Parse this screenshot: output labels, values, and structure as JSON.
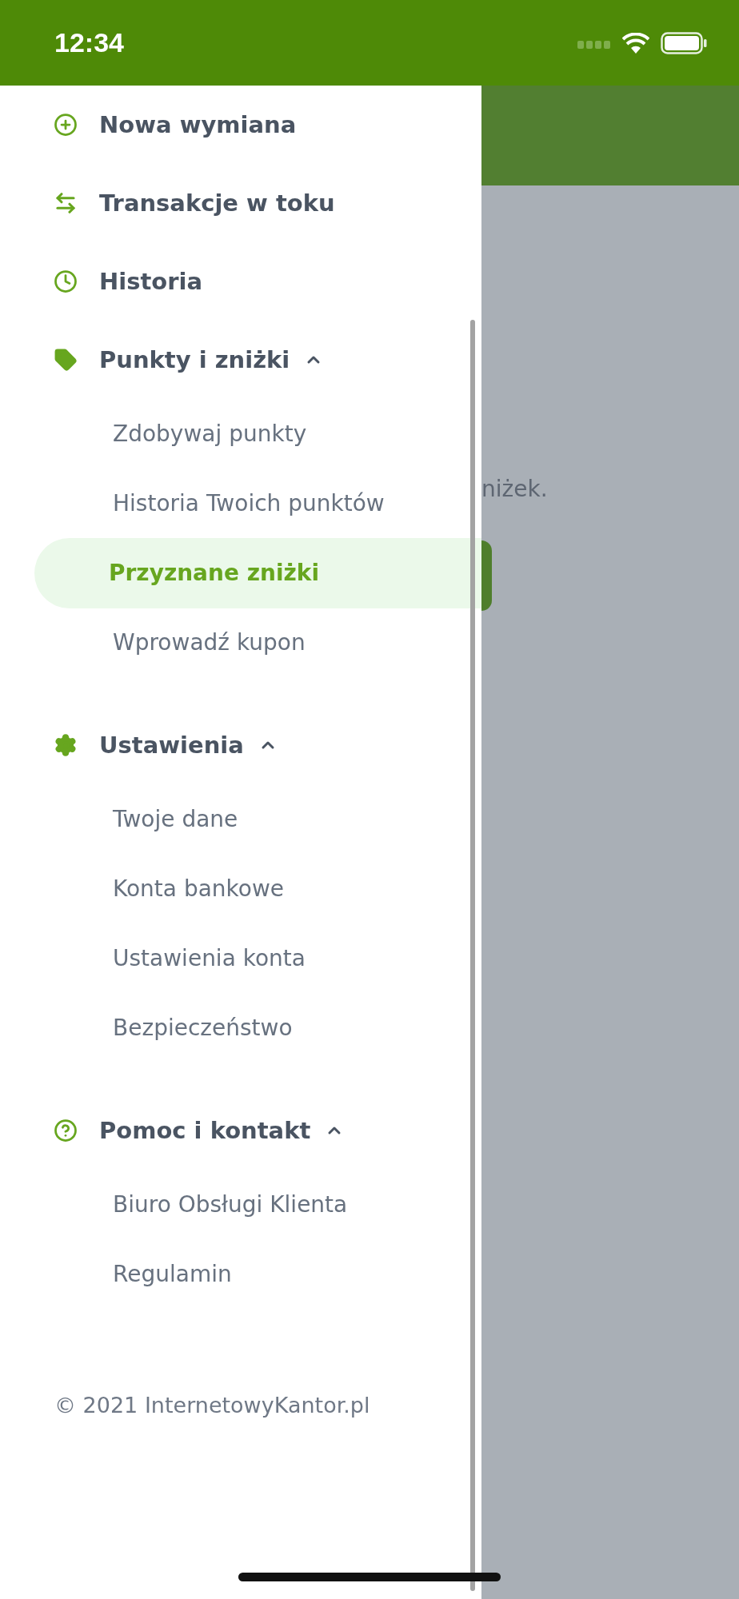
{
  "status_bar": {
    "time": "12:34"
  },
  "menu": [
    {
      "label": "Nowa wymiana"
    },
    {
      "label": "Transakcje w toku"
    },
    {
      "label": "Historia"
    },
    {
      "label": "Punkty i zniżki",
      "expanded": true,
      "children": [
        {
          "label": "Zdobywaj punkty",
          "selected": false
        },
        {
          "label": "Historia Twoich punktów",
          "selected": false
        },
        {
          "label": "Przyznane zniżki",
          "selected": true
        },
        {
          "label": "Wprowadź kupon",
          "selected": false
        }
      ]
    },
    {
      "label": "Ustawienia",
      "expanded": true,
      "children": [
        {
          "label": "Twoje dane",
          "selected": false
        },
        {
          "label": "Konta bankowe",
          "selected": false
        },
        {
          "label": "Ustawienia konta",
          "selected": false
        },
        {
          "label": "Bezpieczeństwo",
          "selected": false
        }
      ]
    },
    {
      "label": "Pomoc i kontakt",
      "expanded": true,
      "children": [
        {
          "label": "Biuro Obsługi Klienta",
          "selected": false
        },
        {
          "label": "Regulamin",
          "selected": false
        }
      ]
    }
  ],
  "footer": "© 2021 InternetowyKantor.pl",
  "background": {
    "text": "niżek."
  }
}
